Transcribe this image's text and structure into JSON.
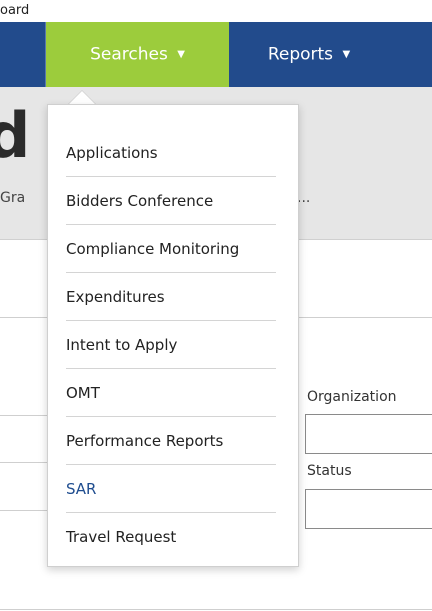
{
  "top_crumb": "oard",
  "navbar": {
    "searches_label": "Searches",
    "reports_label": "Reports",
    "caret": "▼"
  },
  "hero": {
    "title_fragment": "d",
    "subtitle_fragment": "Gra",
    "ellipsis": "..."
  },
  "search_menu": {
    "items": [
      {
        "label": "Applications"
      },
      {
        "label": "Bidders Conference"
      },
      {
        "label": "Compliance Monitoring"
      },
      {
        "label": "Expenditures"
      },
      {
        "label": "Intent to Apply"
      },
      {
        "label": "OMT"
      },
      {
        "label": "Performance Reports"
      },
      {
        "label": "SAR",
        "active": true
      },
      {
        "label": "Travel Request"
      }
    ]
  },
  "form": {
    "organization_label": "Organization",
    "organization_value": "",
    "status_label": "Status",
    "status_value": ""
  },
  "colors": {
    "navbar": "#224b8c",
    "searches_active": "#9ccc3c",
    "menu_active_text": "#1f4d8f"
  }
}
